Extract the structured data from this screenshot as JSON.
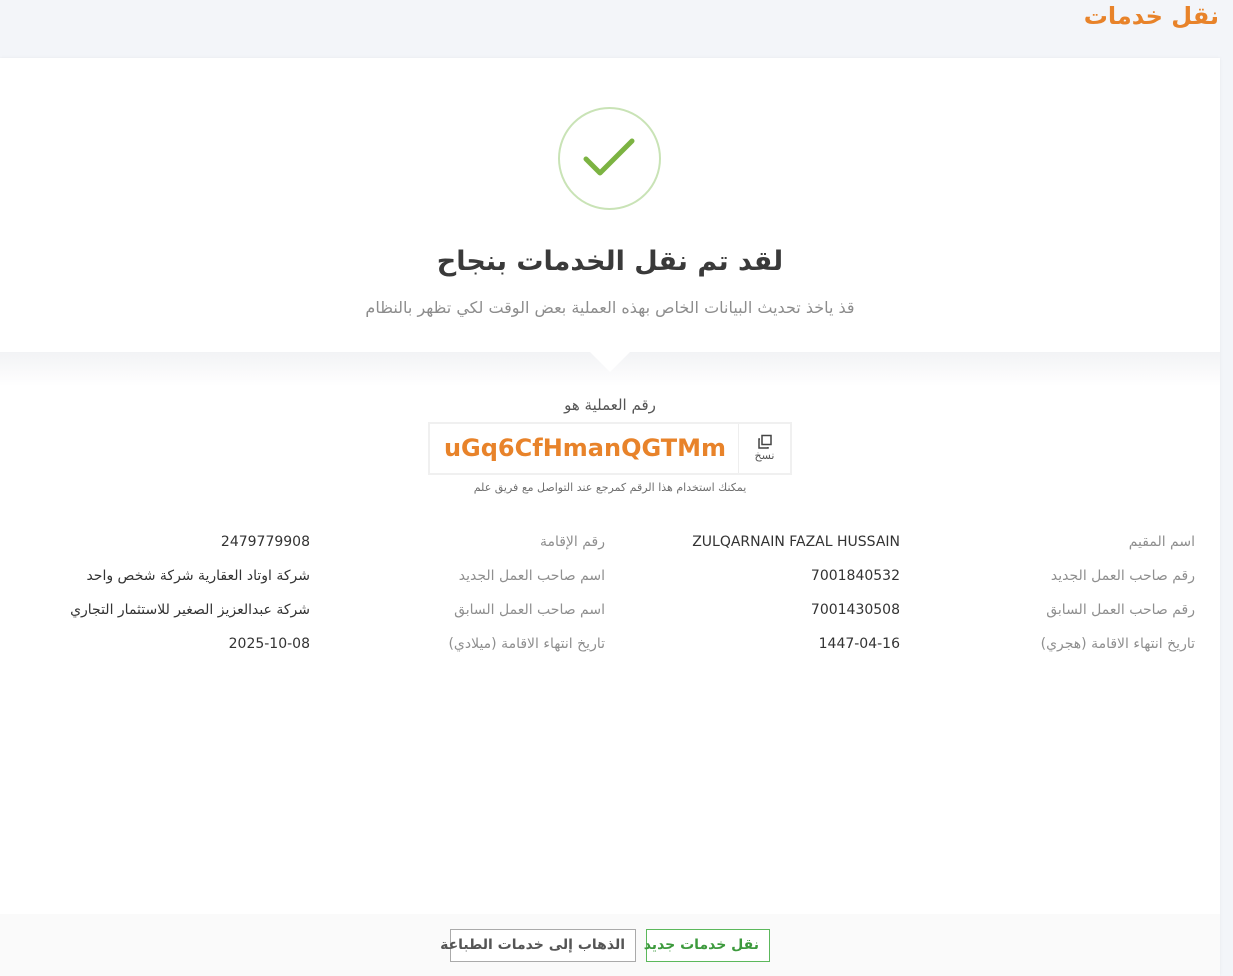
{
  "header": {
    "title": "نقل خدمات"
  },
  "success": {
    "title": "لقد تم نقل الخدمات بنجاح",
    "subtitle": "قذ ياخذ تحديث البيانات الخاص بهذه العملية بعض الوقت لكي تظهر بالنظام",
    "icon": "check-icon",
    "accent_color": "#7cb342"
  },
  "reference": {
    "label": "رقم العملية هو",
    "code": "uGq6CfHmanQGTMm",
    "copy_label": "نسخ",
    "hint": "يمكنك استخدام هذا الرقم كمرجع عند التواصل مع فريق علم"
  },
  "details": {
    "resident_name_label": "اسم المقيم",
    "resident_name": "ZULQARNAIN FAZAL HUSSAIN",
    "iqama_number_label": "رقم الإقامة",
    "iqama_number": "2479779908",
    "new_employer_number_label": "رقم صاحب العمل الجديد",
    "new_employer_number": "7001840532",
    "new_employer_name_label": "اسم صاحب العمل الجديد",
    "new_employer_name": "شركة اوتاد العقارية شركة شخص واحد",
    "prev_employer_number_label": "رقم صاحب العمل السابق",
    "prev_employer_number": "7001430508",
    "prev_employer_name_label": "اسم صاحب العمل السابق",
    "prev_employer_name": "شركة عبدالعزيز الصغير للاستثمار التجاري",
    "iqama_expiry_hijri_label": "تاريخ انتهاء الاقامة (هجري)",
    "iqama_expiry_hijri": "1447-04-16",
    "iqama_expiry_gregorian_label": "تاريخ انتهاء الاقامة (ميلادي)",
    "iqama_expiry_gregorian": "2025-10-08"
  },
  "footer": {
    "new_transfer_label": "نقل خدمات جديد",
    "print_services_label": "الذهاب إلى خدمات الطباعة"
  },
  "colors": {
    "accent_orange": "#e8832a",
    "success_green": "#5cb85c",
    "background": "#f3f5f9"
  }
}
